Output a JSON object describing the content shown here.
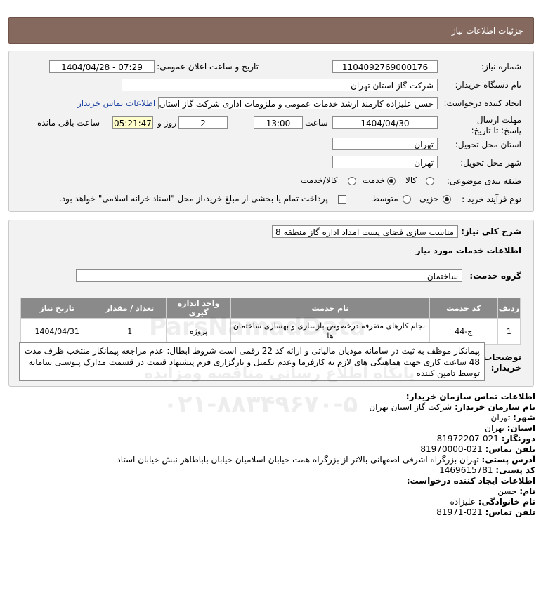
{
  "header": {
    "title": "جزئیات اطلاعات نیاز"
  },
  "form": {
    "need_number_label": "شماره نیاز:",
    "need_number": "1104092769000176",
    "announce_label": "تاریخ و ساعت اعلان عمومی:",
    "announce_value": "1404/04/28 - 07:29",
    "buyer_org_label": "نام دستگاه خریدار:",
    "buyer_org": "شرکت گاز استان تهران",
    "creator_label": "ایجاد کننده درخواست:",
    "creator": "حسن علیزاده کارمند ارشد خدمات عمومی و ملزومات اداری شرکت گاز استان تهران",
    "contact_link": "اطلاعات تماس خریدار",
    "deadline_label": "مهلت ارسال پاسخ: تا تاریخ:",
    "deadline_date": "1404/04/30",
    "time_label": "ساعت",
    "deadline_time": "13:00",
    "days_value": "2",
    "days_label": "روز و",
    "remaining_time": "05:21:47",
    "remaining_label": "ساعت باقی مانده",
    "province_label": "استان محل تحویل:",
    "province": "تهران",
    "city_label": "شهر محل تحویل:",
    "city": "تهران",
    "category_label": "طبقه بندی موضوعی:",
    "category_options": [
      "کالا",
      "خدمت",
      "کالا/خدمت"
    ],
    "category_selected": "خدمت",
    "process_label": "نوع فرآیند خرید :",
    "process_options": [
      "جزیی",
      "متوسط"
    ],
    "process_selected": "جزیی",
    "treasury_note": "پرداخت تمام یا بخشی از مبلغ خرید،از محل \"اسناد خزانه اسلامی\" خواهد بود."
  },
  "summary": {
    "label": "شرح کلي نياز:",
    "value": "مناسب سازی فضای پست امداد اداره گاز منطقه 8",
    "services_heading": "اطلاعات خدمات مورد نیاز",
    "group_label": "گروه خدمت:",
    "group_value": "ساختمان"
  },
  "table": {
    "headers": [
      "ردیف",
      "کد خدمت",
      "نام خدمت",
      "واحد اندازه گیری",
      "تعداد / مقدار",
      "تاریخ نیاز"
    ],
    "rows": [
      [
        "1",
        "ج-44",
        "انجام کارهای متفرقه درخصوص بازسازی و بهسازی ساختمان ها",
        "پروژه",
        "1",
        "1404/04/31"
      ]
    ]
  },
  "notes": {
    "label": "توضیحات خریدار:",
    "text": "پیمانکار موظف به ثبت در سامانه مودیان مالیاتی و ارائه کد 22 رقمی است شروط ابطال: عدم مراجعه پیمانکار منتخب ظرف مدت 48 ساعت کاری جهت هماهنگی های لازم به کارفرما وعدم تکمیل و بارگزاری فرم پیشنهاد قیمت در قسمت مدارک پیوستی سامانه توسط تامین کننده"
  },
  "contact": {
    "heading": "اطلاعات تماس سازمان خریدار:",
    "org_label": "نام سازمان خریدار:",
    "org": "شرکت گاز استان تهران",
    "city_label": "شهر:",
    "city": "تهران",
    "province_label": "استان:",
    "province": "تهران",
    "fax_label": "دورنگار:",
    "fax": "021-81972207",
    "phone_label": "تلفن تماس:",
    "phone": "021-81970000",
    "address_label": "آدرس پستی:",
    "address": "تهران بزرگراه اشرفی اصفهانی بالاتر از بزرگراه همت خیابان اسلامیان خیابان باباطاهر نبش خیابان استاد",
    "postal_label": "کد پستی:",
    "postal": "1469615781",
    "creator_heading": "اطلاعات ایجاد کننده درخواست:",
    "name_label": "نام:",
    "name": "حسن",
    "family_label": "نام خانوادگی:",
    "family": "علیزاده",
    "creator_phone_label": "تلفن تماس:",
    "creator_phone": "021-81971"
  },
  "watermark": {
    "brand": "ParsNamadData",
    "caption": "پایگاه اطلاع رسانی مناقصه ومزایده",
    "phone": "۰۲۱-۸۸۳۴۹۶۷۰-۵"
  }
}
